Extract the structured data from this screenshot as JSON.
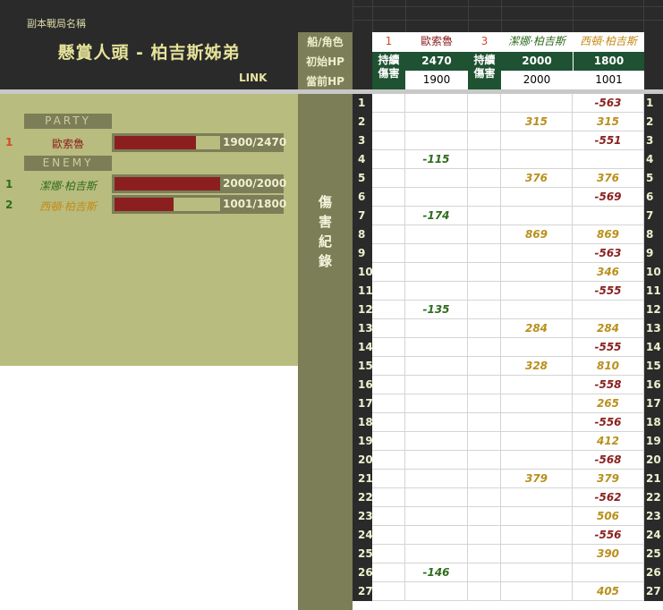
{
  "header": {
    "label_small": "副本戰局名稱",
    "title": "懸賞人頭 - 柏吉斯姊弟",
    "link": "LINK"
  },
  "info": {
    "labels": {
      "ship_role": "船/角色",
      "initial_hp": "初始HP",
      "current_hp": "當前HP"
    },
    "persistent_damage": "持續傷害",
    "party_index": "1",
    "party_name": "歐索魯",
    "party_initial_hp": "2470",
    "party_current_hp": "1900",
    "enemy_index": "3",
    "enemy1_name": "潔娜·柏吉斯",
    "enemy1_initial_hp": "2000",
    "enemy1_current_hp": "2000",
    "enemy2_name": "西頓·柏吉斯",
    "enemy2_initial_hp": "1800",
    "enemy2_current_hp": "1001"
  },
  "panel": {
    "party_label": "PARTY",
    "enemy_label": "ENEMY",
    "party": [
      {
        "index": "1",
        "name": "歐索魯",
        "hp_text": "1900/2470",
        "hp_fraction": 0.769
      }
    ],
    "enemies": [
      {
        "index": "1",
        "name": "潔娜·柏吉斯",
        "hp_text": "2000/2000",
        "hp_fraction": 1.0
      },
      {
        "index": "2",
        "name": "西頓·柏吉斯",
        "hp_text": "1001/1800",
        "hp_fraction": 0.556
      }
    ]
  },
  "log": {
    "label": "傷害紀錄",
    "rows": [
      {
        "n": "1",
        "party": "",
        "enemy1": "",
        "enemy2": "-563",
        "enemy2_color": "neg"
      },
      {
        "n": "2",
        "party": "",
        "enemy1": "315",
        "enemy2": "315",
        "enemy2_color": "pos"
      },
      {
        "n": "3",
        "party": "",
        "enemy1": "",
        "enemy2": "-551",
        "enemy2_color": "neg"
      },
      {
        "n": "4",
        "party": "-115",
        "enemy1": "",
        "enemy2": "",
        "enemy2_color": "neg"
      },
      {
        "n": "5",
        "party": "",
        "enemy1": "376",
        "enemy2": "376",
        "enemy2_color": "pos"
      },
      {
        "n": "6",
        "party": "",
        "enemy1": "",
        "enemy2": "-569",
        "enemy2_color": "neg"
      },
      {
        "n": "7",
        "party": "-174",
        "enemy1": "",
        "enemy2": "",
        "enemy2_color": "neg"
      },
      {
        "n": "8",
        "party": "",
        "enemy1": "869",
        "enemy2": "869",
        "enemy2_color": "pos"
      },
      {
        "n": "9",
        "party": "",
        "enemy1": "",
        "enemy2": "-563",
        "enemy2_color": "neg"
      },
      {
        "n": "10",
        "party": "",
        "enemy1": "",
        "enemy2": "346",
        "enemy2_color": "pos"
      },
      {
        "n": "11",
        "party": "",
        "enemy1": "",
        "enemy2": "-555",
        "enemy2_color": "neg"
      },
      {
        "n": "12",
        "party": "-135",
        "enemy1": "",
        "enemy2": "",
        "enemy2_color": "neg"
      },
      {
        "n": "13",
        "party": "",
        "enemy1": "284",
        "enemy2": "284",
        "enemy2_color": "pos"
      },
      {
        "n": "14",
        "party": "",
        "enemy1": "",
        "enemy2": "-555",
        "enemy2_color": "neg"
      },
      {
        "n": "15",
        "party": "",
        "enemy1": "328",
        "enemy2": "810",
        "enemy2_color": "pos"
      },
      {
        "n": "16",
        "party": "",
        "enemy1": "",
        "enemy2": "-558",
        "enemy2_color": "neg"
      },
      {
        "n": "17",
        "party": "",
        "enemy1": "",
        "enemy2": "265",
        "enemy2_color": "pos"
      },
      {
        "n": "18",
        "party": "",
        "enemy1": "",
        "enemy2": "-556",
        "enemy2_color": "neg"
      },
      {
        "n": "19",
        "party": "",
        "enemy1": "",
        "enemy2": "412",
        "enemy2_color": "pos"
      },
      {
        "n": "20",
        "party": "",
        "enemy1": "",
        "enemy2": "-568",
        "enemy2_color": "neg"
      },
      {
        "n": "21",
        "party": "",
        "enemy1": "379",
        "enemy2": "379",
        "enemy2_color": "pos"
      },
      {
        "n": "22",
        "party": "",
        "enemy1": "",
        "enemy2": "-562",
        "enemy2_color": "neg"
      },
      {
        "n": "23",
        "party": "",
        "enemy1": "",
        "enemy2": "506",
        "enemy2_color": "pos"
      },
      {
        "n": "24",
        "party": "",
        "enemy1": "",
        "enemy2": "-556",
        "enemy2_color": "neg"
      },
      {
        "n": "25",
        "party": "",
        "enemy1": "",
        "enemy2": "390",
        "enemy2_color": "pos"
      },
      {
        "n": "26",
        "party": "-146",
        "enemy1": "",
        "enemy2": "",
        "enemy2_color": "neg"
      },
      {
        "n": "27",
        "party": "",
        "enemy1": "",
        "enemy2": "405",
        "enemy2_color": "pos"
      }
    ]
  },
  "colors": {
    "party_name": "#8b1f1f",
    "party_index": "#d04a2a",
    "enemy1_name": "#2f6b1e",
    "enemy2_name": "#c48a16",
    "party_damage": "#2f6b1e",
    "heal": "#b8901c",
    "damage": "#8b1f1f"
  }
}
